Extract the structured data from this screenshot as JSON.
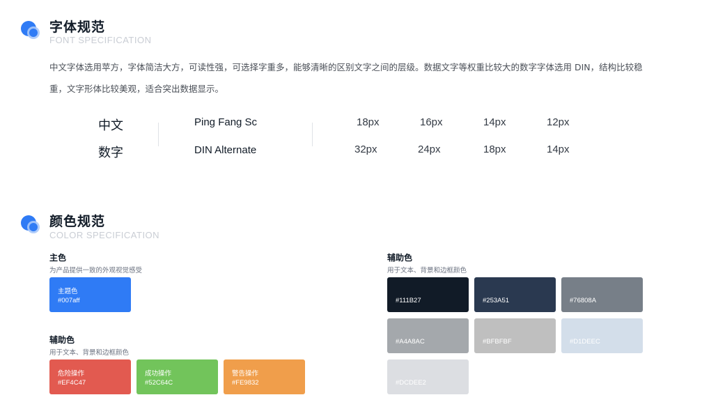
{
  "font_section": {
    "title": "字体规范",
    "subtitle": "FONT SPECIFICATION",
    "description_line1": "中文字体选用苹方，字体简洁大方，可读性强，可选择字重多，能够清晰的区别文字之间的层级。数据文字等权重比较大的数字字体选用 DIN，结构比较稳",
    "description_line2": "重，文字形体比较美观，适合突出数据显示。",
    "rows": [
      {
        "label": "中文",
        "font": "Ping Fang Sc",
        "sizes": [
          "18px",
          "16px",
          "14px",
          "12px"
        ]
      },
      {
        "label": "数字",
        "font": "DIN Alternate",
        "sizes": [
          "32px",
          "24px",
          "18px",
          "14px"
        ]
      }
    ]
  },
  "color_section": {
    "title": "颜色规范",
    "subtitle": "COLOR SPECIFICATION",
    "primary": {
      "title": "主色",
      "desc": "为产品提供一致的外观视觉感受",
      "swatches": [
        {
          "name": "主题色",
          "hex": "#007aff",
          "color": "#2F7BF5"
        }
      ]
    },
    "secondary_left": {
      "title": "辅助色",
      "desc": "用于文本、背景和边框颜色",
      "swatches": [
        {
          "name": "危险操作",
          "hex": "#EF4C47",
          "color": "#E25A50"
        },
        {
          "name": "成功操作",
          "hex": "#52C64C",
          "color": "#72C45B"
        },
        {
          "name": "警告操作",
          "hex": "#FE9832",
          "color": "#F09E4B"
        }
      ]
    },
    "secondary_right": {
      "title": "辅助色",
      "desc": "用于文本、背景和边框颜色",
      "swatches": [
        {
          "hex": "#111B27",
          "color": "#111B27"
        },
        {
          "hex": "#253A51",
          "color": "#2A3950"
        },
        {
          "hex": "#76808A",
          "color": "#777F88"
        },
        {
          "hex": "#A4A8AC",
          "color": "#A4A8AC"
        },
        {
          "hex": "#BFBFBF",
          "color": "#BFBFBF"
        },
        {
          "hex": "#D1DEEC",
          "color": "#D3DEEA"
        },
        {
          "hex": "#DCDEE2",
          "color": "#DCDEE2"
        }
      ]
    }
  },
  "colors": {
    "logo_blue": "#2F7BF5",
    "logo_light": "#A9C8FA"
  }
}
